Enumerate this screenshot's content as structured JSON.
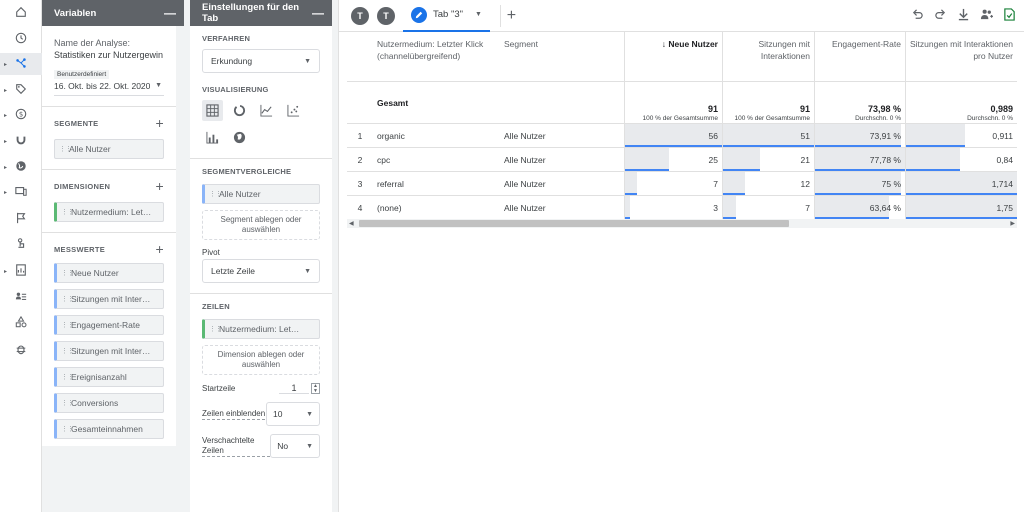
{
  "rail": {
    "icons": [
      "home-icon",
      "history-icon",
      "explore-icon",
      "tag-icon",
      "dollar-icon",
      "magnet-icon",
      "globe-icon",
      "devices-icon",
      "flag-icon",
      "touch-icon",
      "report-icon",
      "user-list-icon",
      "shapes-icon",
      "bug-icon"
    ],
    "active_index": 2,
    "caret_indexes": [
      2,
      3,
      4,
      5,
      6,
      7,
      10
    ]
  },
  "variables": {
    "title": "Variablen",
    "analysis_label": "Name der Analyse:",
    "analysis_name": "Statistiken zur Nutzergewin …",
    "date_label": "Benutzerdefiniert",
    "date_range": "16. Okt. bis 22. Okt. 2020",
    "segments_title": "SEGMENTE",
    "segments": [
      "Alle Nutzer"
    ],
    "dimensions_title": "DIMENSIONEN",
    "dimensions": [
      "Nutzermedium: Let…"
    ],
    "metrics_title": "MESSWERTE",
    "metrics": [
      "Neue Nutzer",
      "Sitzungen mit Inter…",
      "Engagement-Rate",
      "Sitzungen mit Inter…",
      "Ereignisanzahl",
      "Conversions",
      "Gesamteinnahmen"
    ]
  },
  "tab_settings": {
    "title": "Einstellungen für den Tab",
    "technique_title": "VERFAHREN",
    "technique_value": "Erkundung",
    "viz_title": "VISUALISIERUNG",
    "viz_icons": [
      "table-icon",
      "donut-icon",
      "line-chart-icon",
      "scatter-icon",
      "bar-chart-icon",
      "geo-icon"
    ],
    "segment_compare_title": "SEGMENTVERGLEICHE",
    "segment_compare_chip": "Alle Nutzer",
    "segment_drop": "Segment ablegen oder auswählen",
    "pivot_label": "Pivot",
    "pivot_value": "Letzte Zeile",
    "rows_title": "ZEILEN",
    "rows_chip": "Nutzermedium: Let…",
    "rows_drop": "Dimension ablegen oder auswählen",
    "start_row_label": "Startzeile",
    "start_row_value": "1",
    "show_rows_label": "Zeilen einblenden",
    "show_rows_value": "10",
    "nested_rows_label": "Verschachtelte Zeilen",
    "nested_rows_value": "No"
  },
  "canvas": {
    "tab_avatars": [
      "T",
      "T"
    ],
    "active_tab": "Tab \"3\"",
    "toolbar_icons": [
      "undo-icon",
      "redo-icon",
      "download-icon",
      "share-icon",
      "export-sheet-icon"
    ]
  },
  "table": {
    "headers": {
      "dimension": "Nutzermedium: Letzter Klick (channelübergreifend)",
      "segment": "Segment",
      "m1": "↓ Neue Nutzer",
      "m2": "Sitzungen mit Interaktionen",
      "m3": "Engagement-Rate",
      "m4": "Sitzungen mit Interaktionen pro Nutzer"
    },
    "total": {
      "label": "Gesamt",
      "m1": "91",
      "m1_sub": "100 % der Gesamtsumme",
      "m2": "91",
      "m2_sub": "100 % der Gesamtsumme",
      "m3": "73,98 %",
      "m3_sub": "Durchschn. 0 %",
      "m4": "0,989",
      "m4_sub": "Durchschn. 0 %"
    },
    "rows": [
      {
        "idx": "1",
        "dim": "organic",
        "seg": "Alle Nutzer",
        "m1": "56",
        "m2": "51",
        "m3": "73,91 %",
        "m4": "0,911",
        "f1": 1.0,
        "f2": 1.0,
        "f3": 0.95,
        "f4": 0.53
      },
      {
        "idx": "2",
        "dim": "cpc",
        "seg": "Alle Nutzer",
        "m1": "25",
        "m2": "21",
        "m3": "77,78 %",
        "m4": "0,84",
        "f1": 0.45,
        "f2": 0.41,
        "f3": 1.0,
        "f4": 0.49
      },
      {
        "idx": "3",
        "dim": "referral",
        "seg": "Alle Nutzer",
        "m1": "7",
        "m2": "12",
        "m3": "75 %",
        "m4": "1,714",
        "f1": 0.12,
        "f2": 0.24,
        "f3": 0.96,
        "f4": 1.0
      },
      {
        "idx": "4",
        "dim": "(none)",
        "seg": "Alle Nutzer",
        "m1": "3",
        "m2": "7",
        "m3": "63,64 %",
        "m4": "1,75",
        "f1": 0.05,
        "f2": 0.14,
        "f3": 0.82,
        "f4": 1.0
      }
    ]
  }
}
